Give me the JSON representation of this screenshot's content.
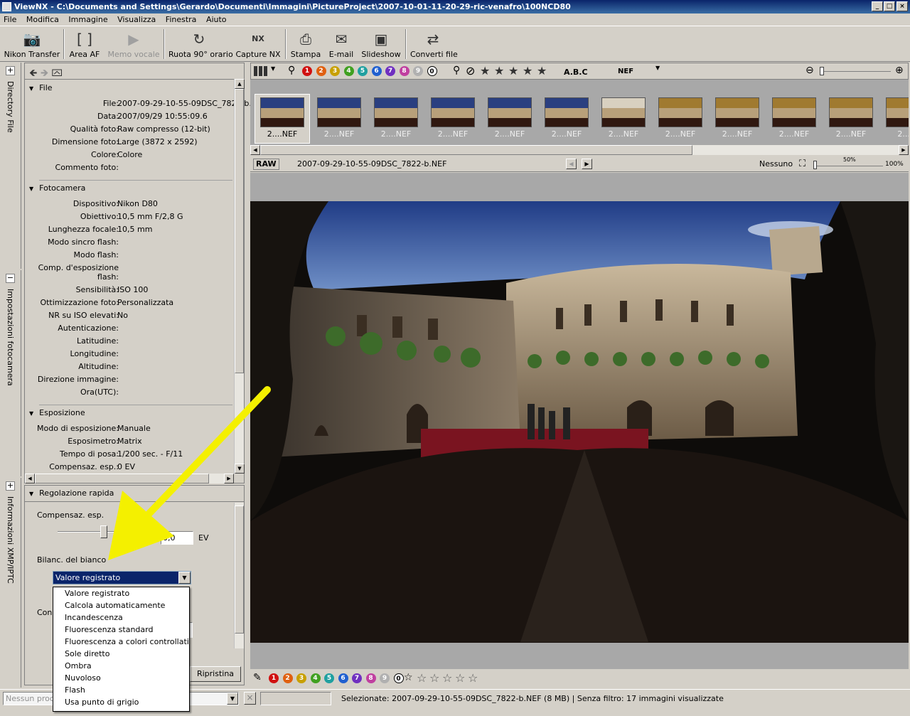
{
  "window": {
    "title": "ViewNX - C:\\Documents and Settings\\Gerardo\\Documenti\\Immagini\\PictureProject\\2007-10-01-11-20-29-ric-venafro\\100NCD80",
    "min": "_",
    "max": "□",
    "close": "×"
  },
  "menu": [
    "File",
    "Modifica",
    "Immagine",
    "Visualizza",
    "Finestra",
    "Aiuto"
  ],
  "toolbar": [
    {
      "label": "Nikon Transfer",
      "icon": "camera-icon",
      "glyph": "📷",
      "enabled": true
    },
    {
      "label": "Area AF",
      "icon": "af-area-icon",
      "glyph": "[ ]",
      "enabled": true
    },
    {
      "label": "Memo vocale",
      "icon": "voice-memo-icon",
      "glyph": "▶",
      "enabled": false
    },
    {
      "label": "Ruota 90° orario",
      "icon": "rotate-icon",
      "glyph": "↻",
      "enabled": true
    },
    {
      "label": "Capture NX",
      "icon": "capture-nx-icon",
      "glyph": "NX",
      "enabled": true
    },
    {
      "label": "Stampa",
      "icon": "print-icon",
      "glyph": "⎙",
      "enabled": true
    },
    {
      "label": "E-mail",
      "icon": "email-icon",
      "glyph": "✉",
      "enabled": true
    },
    {
      "label": "Slideshow",
      "icon": "slideshow-icon",
      "glyph": "▣",
      "enabled": true
    },
    {
      "label": "Converti file",
      "icon": "convert-icon",
      "glyph": "⇄",
      "enabled": true
    }
  ],
  "side_tabs": {
    "directory": "Directory File",
    "camera": "Impostazioni fotocamera",
    "xmp": "Informazioni XMP/IPTC"
  },
  "file_section": {
    "header": "File",
    "rows": [
      {
        "k": "File:",
        "v": "2007-09-29-10-55-09DSC_7822-b."
      },
      {
        "k": "Data:",
        "v": "2007/09/29 10:55:09.6"
      },
      {
        "k": "Qualità foto:",
        "v": "Raw compresso (12-bit)"
      },
      {
        "k": "Dimensione foto:",
        "v": "Large (3872 x 2592)"
      },
      {
        "k": "Colore:",
        "v": "Colore"
      },
      {
        "k": "Commento foto:",
        "v": ""
      }
    ]
  },
  "camera_section": {
    "header": "Fotocamera",
    "rows": [
      {
        "k": "Dispositivo:",
        "v": "Nikon D80"
      },
      {
        "k": "Obiettivo:",
        "v": "10,5 mm F/2,8 G"
      },
      {
        "k": "Lunghezza focale:",
        "v": "10,5 mm"
      },
      {
        "k": "Modo sincro flash:",
        "v": ""
      },
      {
        "k": "Modo flash:",
        "v": ""
      },
      {
        "k": "Comp. d'esposizione",
        "v": ""
      },
      {
        "k": "flash:",
        "v": ""
      },
      {
        "k": "Sensibilità:",
        "v": "ISO 100"
      },
      {
        "k": "Ottimizzazione foto:",
        "v": "Personalizzata"
      },
      {
        "k": "NR su ISO elevati:",
        "v": "No"
      },
      {
        "k": "Autenticazione:",
        "v": ""
      },
      {
        "k": "Latitudine:",
        "v": ""
      },
      {
        "k": "Longitudine:",
        "v": ""
      },
      {
        "k": "Altitudine:",
        "v": ""
      },
      {
        "k": "Direzione immagine:",
        "v": ""
      },
      {
        "k": "Ora(UTC):",
        "v": ""
      }
    ]
  },
  "exposure_section": {
    "header": "Esposizione",
    "rows": [
      {
        "k": "Modo di esposizione:",
        "v": "Manuale"
      },
      {
        "k": "Esposimetro:",
        "v": "Matrix"
      },
      {
        "k": "Tempo di posa:",
        "v": "1/200 sec. - F/11"
      },
      {
        "k": "Compensaz. esp.:",
        "v": "0 EV"
      }
    ]
  },
  "quick_adjust": {
    "header": "Regolazione rapida",
    "exp_label": "Compensaz. esp.",
    "exp_value": "0,0",
    "exp_unit": "EV",
    "wb_label": "Bilanc. del bianco",
    "wb_selected": "Valore registrato",
    "contrast_label_partial": "Con",
    "reset_button": "Ripristina",
    "wb_options": [
      "Valore registrato",
      "Calcola automaticamente",
      "Incandescenza",
      "Fluorescenza standard",
      "Fluorescenza a colori controllati",
      "Sole diretto",
      "Ombra",
      "Nuvoloso",
      "Flash",
      "Usa punto di grigio"
    ]
  },
  "filter_bar": {
    "labels": [
      "1",
      "2",
      "3",
      "4",
      "5",
      "6",
      "7",
      "8",
      "9",
      "0"
    ],
    "label_colors": [
      "#d01010",
      "#e06010",
      "#c8a000",
      "#40a020",
      "#20a0a0",
      "#2060d0",
      "#7030c0",
      "#c040a0",
      "#b0b0b0",
      "#ffffff"
    ],
    "abc": "A.B.C",
    "format": "NEF"
  },
  "thumbnails": [
    "2....NEF",
    "2....NEF",
    "2....NEF",
    "2....NEF",
    "2....NEF",
    "2....NEF",
    "2....NEF",
    "2....NEF",
    "2....NEF",
    "2....NEF",
    "2....NEF",
    "2....N"
  ],
  "info_bar": {
    "raw": "RAW",
    "filename": "2007-09-29-10-55-09DSC_7822-b.NEF",
    "filter": "Nessuno",
    "zoom_mid": "50%",
    "zoom_max": "100%"
  },
  "status": {
    "proc_placeholder": "Nessun proce",
    "text": "Selezionate: 2007-09-29-10-55-09DSC_7822-b.NEF (8 MB) | Senza filtro: 17 immagini visualizzate"
  }
}
